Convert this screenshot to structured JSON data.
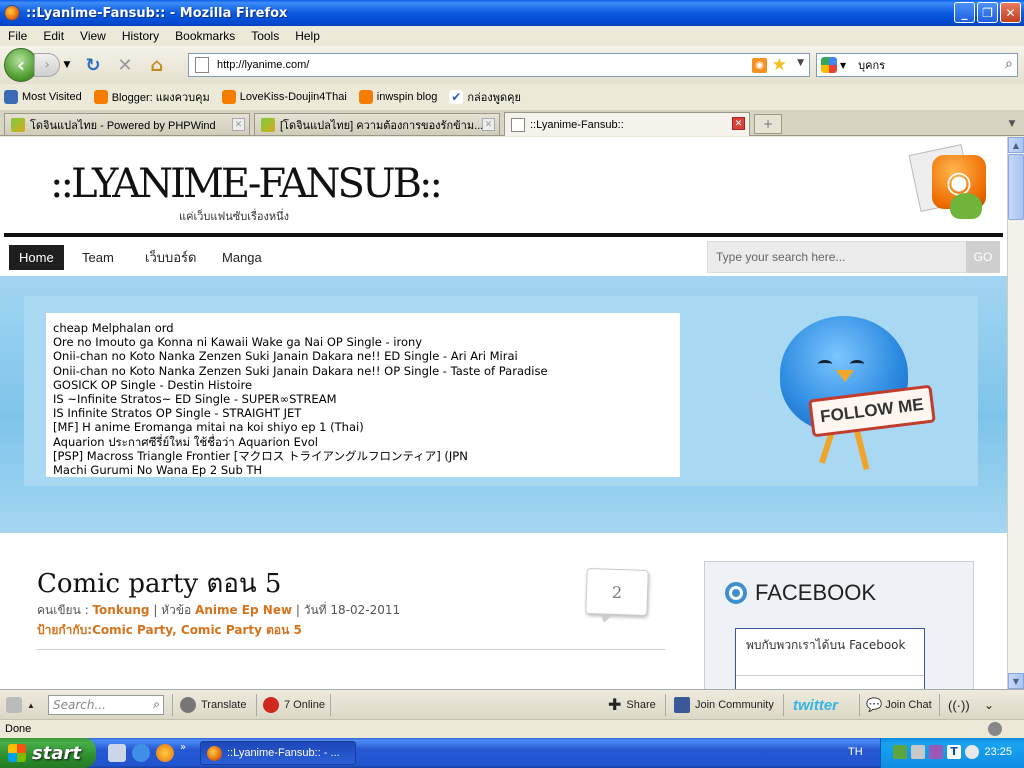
{
  "window": {
    "title": "::Lyanime-Fansub:: - Mozilla Firefox"
  },
  "menu": [
    "File",
    "Edit",
    "View",
    "History",
    "Bookmarks",
    "Tools",
    "Help"
  ],
  "nav": {
    "url": "http://lyanime.com/",
    "search_value": "บุคกร"
  },
  "bookmarks": [
    {
      "label": "Most Visited",
      "icon": "most-visited-icon"
    },
    {
      "label": "Blogger: แผงควบคุม",
      "icon": "blogger-icon"
    },
    {
      "label": "LoveKiss-Doujin4Thai",
      "icon": "blogger-icon"
    },
    {
      "label": "inwspin blog",
      "icon": "blogger-icon"
    },
    {
      "label": "กล่องพูดคุย",
      "icon": "check-icon"
    }
  ],
  "tabs": [
    {
      "label": "โดจินแปลไทย - Powered by PHPWind",
      "active": false
    },
    {
      "label": "[โดจินแปลไทย] ความต้องการของรักข้าม...",
      "active": false
    },
    {
      "label": "::Lyanime-Fansub::",
      "active": true
    }
  ],
  "site": {
    "logo": "::LYANIME-FANSUB::",
    "tagline": "แค่เว็บแฟนซับเรื่องหนึ่ง",
    "nav": [
      "Home",
      "Team",
      "เว็บบอร์ด",
      "Manga"
    ],
    "search_placeholder": "Type your search here...",
    "search_button": "GO",
    "news": [
      "cheap Melphalan ord",
      "Ore no Imouto ga Konna ni Kawaii Wake ga Nai OP Single - irony",
      "Onii-chan no Koto Nanka Zenzen Suki Janain Dakara ne!! ED Single - Ari Ari Mirai",
      "Onii-chan no Koto Nanka Zenzen Suki Janain Dakara ne!! OP Single - Taste of Paradise",
      "GOSICK OP Single - Destin Histoire",
      "IS ~Infinite Stratos~ ED Single - SUPER∞STREAM",
      "IS Infinite Stratos OP Single - STRAIGHT JET",
      "[MF] H anime Eromanga mitai na koi shiyo ep 1 (Thai)",
      "Aquarion ประกาศซีรี่ย์ใหม่ ใช้ชื่อว่า Aquarion Evol",
      "[PSP] Macross Triangle Frontier [マクロス トライアングルフロンティア] (JPN",
      "Machi Gurumi No Wana Ep 2 Sub TH"
    ],
    "follow_me": "FOLLOW ME",
    "post": {
      "title": "Comic party ตอน 5",
      "author_label": "คนเขียน : ",
      "author": "Tonkung",
      "category_label": " | หัวข้อ ",
      "category": "Anime Ep New",
      "date_text": " | วันที่ 18-02-2011",
      "tags": "ป้ายกำกับ:Comic Party, Comic Party ตอน 5",
      "comments": "2"
    },
    "facebook": {
      "title": "FACEBOOK",
      "text": "พบกับพวกเราได้บน Facebook"
    }
  },
  "addonbar": {
    "search_placeholder": "Search...",
    "translate": "Translate",
    "online": "7 Online",
    "share": "Share",
    "join_community": "Join Community",
    "twitter": "twitter",
    "join_chat": "Join Chat"
  },
  "status": "Done",
  "taskbar": {
    "start": "start",
    "task": "::Lyanime-Fansub:: - ...",
    "lang": "TH",
    "clock": "23:25"
  }
}
